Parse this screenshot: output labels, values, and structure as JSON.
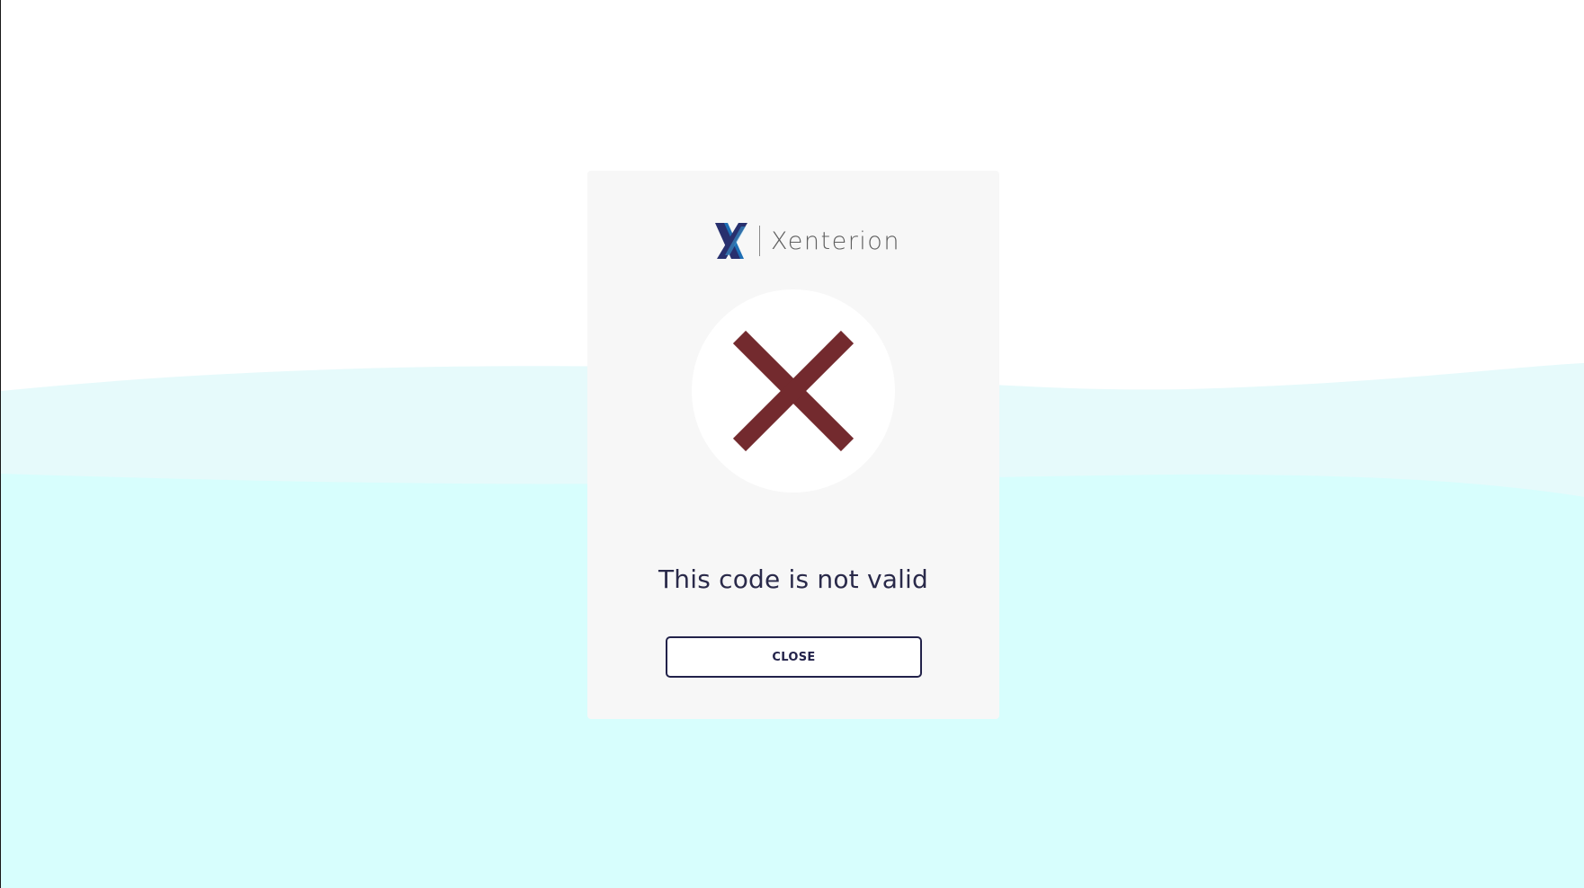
{
  "brand": {
    "name": "Xenterion",
    "icon": "xenterion-x-logo-icon"
  },
  "dialog": {
    "status_icon": "error-x-icon",
    "message": "This code is not valid",
    "close_label": "CLOSE"
  },
  "colors": {
    "background_top": "#ffffff",
    "wave_light": "#e6fafb",
    "wave_main": "#d7fefd",
    "card": "#f7f7f7",
    "error_mark": "#732a2e",
    "logo_dark": "#28306e",
    "logo_blue": "#1e6fb5",
    "text_dark": "#2a2a4a"
  }
}
